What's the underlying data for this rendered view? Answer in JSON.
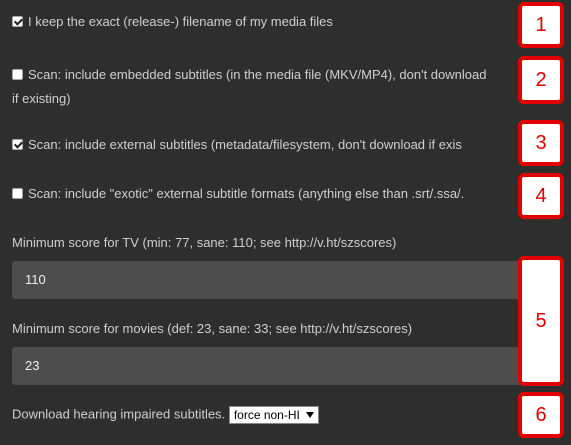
{
  "settings": {
    "keep_filename": {
      "label": "I keep the exact (release-) filename of my media files",
      "checked": true
    },
    "scan_embedded": {
      "label": "Scan: include embedded subtitles (in the media file (MKV/MP4), don't download",
      "label_cont": "if existing)",
      "checked": false
    },
    "scan_external": {
      "label": "Scan: include external subtitles (metadata/filesystem, don't download if exis",
      "checked": true
    },
    "scan_exotic": {
      "label": "Scan: include \"exotic\" external subtitle formats (anything else than .srt/.ssa/.",
      "checked": false
    },
    "min_score_tv": {
      "label": "Minimum score for TV (min: 77, sane: 110; see http://v.ht/szscores)",
      "value": "110"
    },
    "min_score_movies": {
      "label": "Minimum score for movies (def: 23, sane: 33; see http://v.ht/szscores)",
      "value": "23"
    },
    "hearing_impaired": {
      "label": "Download hearing impaired subtitles.",
      "selected": "force non-HI"
    }
  },
  "annotations": [
    "1",
    "2",
    "3",
    "4",
    "5",
    "6"
  ]
}
